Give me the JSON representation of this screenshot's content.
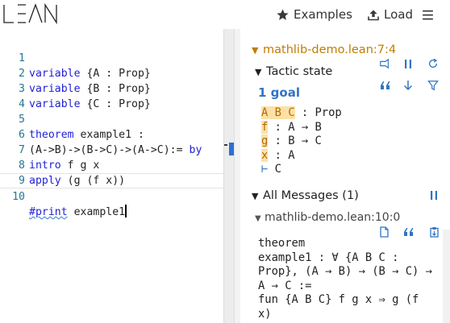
{
  "header": {
    "logo_text": "LEAN",
    "examples_label": "Examples",
    "load_label": "Load",
    "examples_icon": "star-icon",
    "load_icon": "upload-icon",
    "menu_icon": "hamburger-menu-icon"
  },
  "editor": {
    "lines": [
      {
        "num": "1",
        "kw": "variable",
        "rest": " {A : Prop}"
      },
      {
        "num": "2",
        "kw": "variable",
        "rest": " {B : Prop}"
      },
      {
        "num": "3",
        "kw": "variable",
        "rest": " {C : Prop}"
      },
      {
        "num": "4",
        "kw": "",
        "rest": ""
      },
      {
        "num": "5",
        "kw": "theorem",
        "rest": " example1 :"
      },
      {
        "num": "6",
        "kw": "",
        "rest": "(A->B)->(B->C)->(A->C):=",
        "kw2": " by"
      },
      {
        "num": "7",
        "kw": "intro",
        "rest": " f g x"
      },
      {
        "num": "8",
        "kw": "apply",
        "rest": " (g (f x))"
      },
      {
        "num": "9",
        "kw": "",
        "rest": ""
      },
      {
        "num": "10",
        "kw": "#print",
        "rest": " example1"
      }
    ]
  },
  "infoview": {
    "file_label": "mathlib-demo.lean:7:4",
    "tactic_state_label": "Tactic state",
    "goal_count": "1 goal",
    "goal": {
      "vars": "A B C",
      "vars_type": " : Prop",
      "hyps": [
        {
          "name": "f",
          "type": " : A → B"
        },
        {
          "name": "g",
          "type": " : B → C"
        },
        {
          "name": "x",
          "type": " : A"
        }
      ],
      "turnstile": "⊢",
      "target": " C"
    },
    "all_messages_label": "All Messages (1)",
    "message_file_label": "mathlib-demo.lean:10:0",
    "message_lines": [
      "theorem",
      "example1 : ∀ {A B C :",
      "Prop}, (A → B) → (B → C) →",
      "A → C :=",
      "fun {A B C} f g x ⇒ g (f",
      "x)"
    ]
  },
  "colors": {
    "keyword": "#1f1fd6",
    "line_number": "#237893",
    "file_header": "#c07d00",
    "goal_title": "#2f74c4",
    "hypothesis_highlight": "#fbe1a8"
  }
}
